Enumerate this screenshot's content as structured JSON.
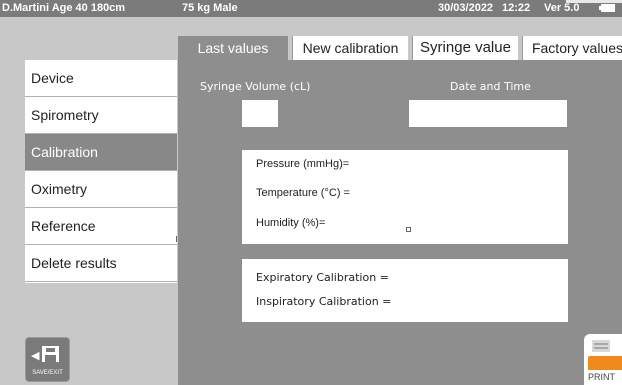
{
  "header": {
    "patient_info": "D.Martini  Age 40  180cm",
    "weight_sex": "75 kg Male",
    "date": "30/03/2022",
    "time": "12:22",
    "version": "Ver 5.0"
  },
  "tabs": [
    {
      "label": "Last values",
      "active": true
    },
    {
      "label": "New calibration",
      "active": false
    },
    {
      "label": "Syringe value",
      "active": false
    },
    {
      "label": "Factory values",
      "active": false
    }
  ],
  "sidebar": {
    "items": [
      {
        "label": "Device",
        "active": false
      },
      {
        "label": "Spirometry",
        "active": false
      },
      {
        "label": "Calibration",
        "active": true
      },
      {
        "label": "Oximetry",
        "active": false
      },
      {
        "label": "Reference",
        "active": false
      },
      {
        "label": "Delete  results",
        "active": false
      }
    ]
  },
  "main": {
    "syringe_volume_label": "Syringe Volume (cL)",
    "syringe_volume_value": "",
    "date_time_label": "Date and Time",
    "date_time_value": "",
    "conditions": {
      "pressure": "Pressure (mmHg)=",
      "temperature": "Temperature (°C) =",
      "humidity": "Humidity (%)="
    },
    "calibration": {
      "expiratory": "Expiratory Calibration =",
      "inspiratory": "Inspiratory Calibration ="
    }
  },
  "buttons": {
    "save_exit": "SAVE/EXIT",
    "print": "PRINT"
  },
  "colors": {
    "topbar": "#7b7b7b",
    "active_tab": "#8e8e8e",
    "print_accent": "#f08a1c"
  }
}
